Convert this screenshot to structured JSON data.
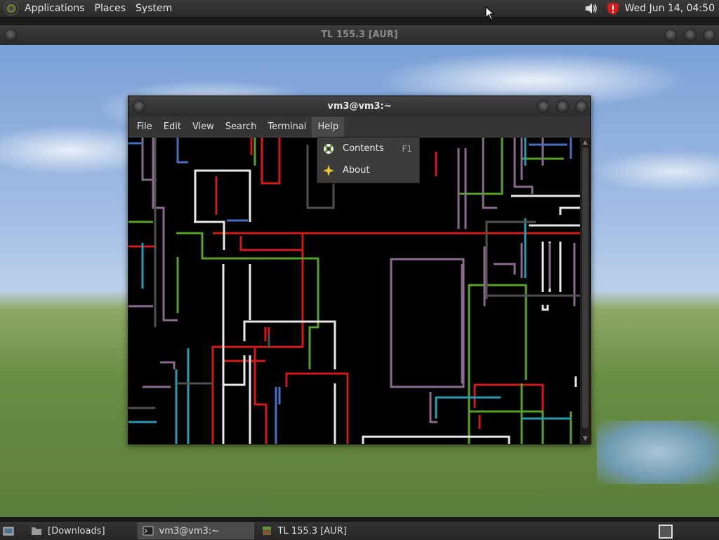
{
  "top_panel": {
    "menus": [
      "Applications",
      "Places",
      "System"
    ],
    "clock": "Wed Jun 14, 04:50",
    "icons": [
      "applications-icon",
      "volume-icon",
      "shield-icon"
    ]
  },
  "outer_window": {
    "title": "TL 155.3 [AUR]"
  },
  "terminal": {
    "title": "vm3@vm3:~",
    "menus": [
      "File",
      "Edit",
      "View",
      "Search",
      "Terminal",
      "Help"
    ],
    "active_menu": "Help"
  },
  "help_menu": {
    "items": [
      {
        "label": "Contents",
        "accel": "F1",
        "icon": "help-lifebuoy-icon"
      },
      {
        "label": "About",
        "accel": "",
        "icon": "about-star-icon"
      }
    ]
  },
  "taskbar": {
    "tasks": [
      {
        "label": "[Downloads]",
        "icon": "folder-icon",
        "active": false
      },
      {
        "label": "vm3@vm3:~",
        "icon": "terminal-icon",
        "active": true
      },
      {
        "label": "TL 155.3 [AUR]",
        "icon": "minecraft-icon",
        "active": false
      }
    ]
  },
  "colors": {
    "pipe_red": "#d11a1a",
    "pipe_green": "#5aa02c",
    "pipe_white": "#e8e8e8",
    "pipe_purple": "#8a6a8e",
    "pipe_cyan": "#2a9bb0",
    "pipe_blue": "#4a6fc0",
    "pipe_gray": "#606060"
  }
}
